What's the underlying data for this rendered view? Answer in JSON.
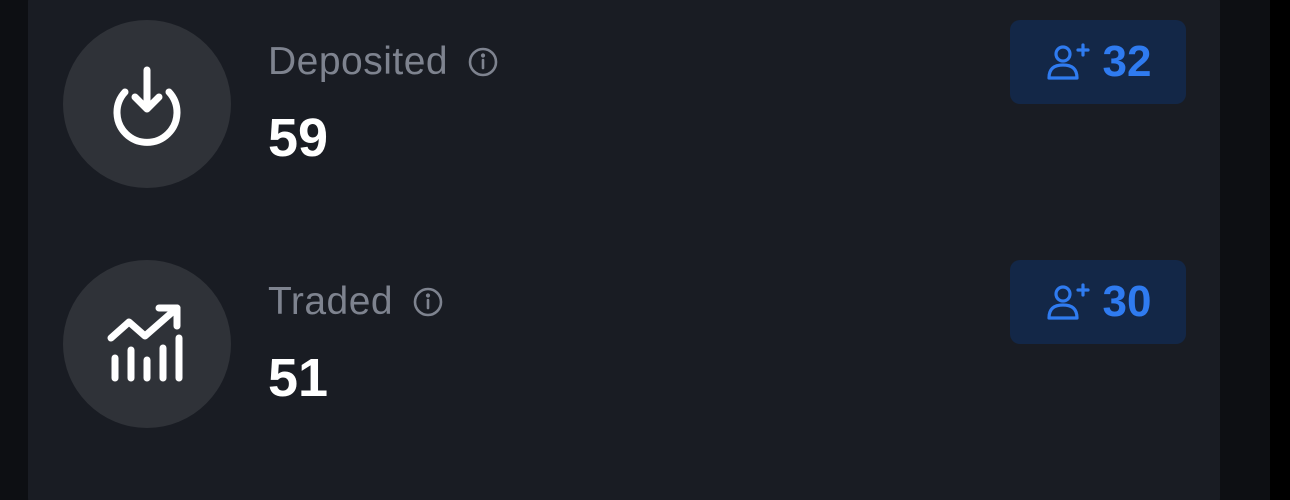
{
  "stats": [
    {
      "id": "deposited",
      "label": "Deposited",
      "value": "59",
      "icon": "download-circle-icon",
      "badge_icon": "user-plus-icon",
      "badge_count": "32"
    },
    {
      "id": "traded",
      "label": "Traded",
      "value": "51",
      "icon": "trending-bars-icon",
      "badge_icon": "user-plus-icon",
      "badge_count": "30"
    }
  ],
  "colors": {
    "card_background": "#191c23",
    "icon_circle": "#2f3238",
    "label": "#7e838f",
    "value": "#ffffff",
    "badge_background": "#132747",
    "badge_accent": "#2f7bf0"
  }
}
